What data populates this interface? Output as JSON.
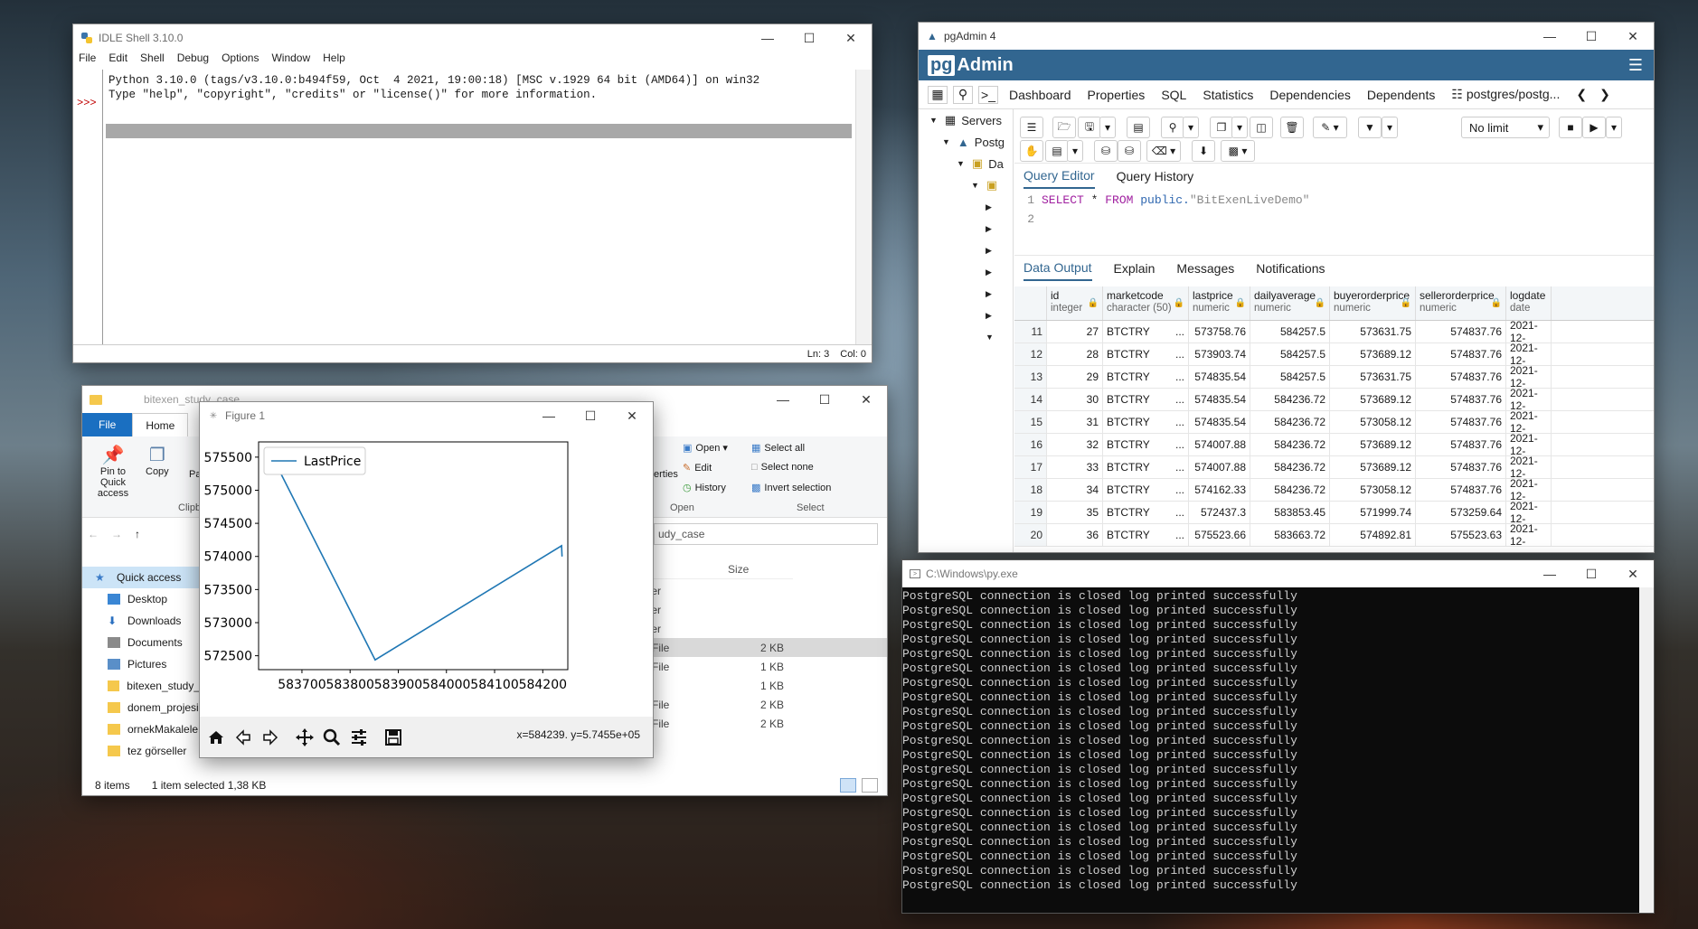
{
  "idle": {
    "title": "IDLE Shell 3.10.0",
    "menu": [
      "File",
      "Edit",
      "Shell",
      "Debug",
      "Options",
      "Window",
      "Help"
    ],
    "lines": [
      "Python 3.10.0 (tags/v3.10.0:b494f59, Oct  4 2021, 19:00:18) [MSC v.1929 64 bit (AMD64)] on win32",
      "Type \"help\", \"copyright\", \"credits\" or \"license()\" for more information."
    ],
    "prompt": ">>>",
    "status_line": "Ln: 3",
    "status_col": "Col: 0"
  },
  "explorer": {
    "title": "bitexen_study_case",
    "tab_file": "File",
    "tab_home": "Home",
    "ribbon": {
      "pin": "Pin to Quick access",
      "copy": "Copy",
      "paste_partial": "Pa",
      "clipboard_partial": "Clipb",
      "properties_partial": "erties",
      "open": "Open",
      "edit": "Edit",
      "history": "History",
      "open_group": "Open",
      "select_all": "Select all",
      "select_none": "Select none",
      "invert_selection": "Invert selection",
      "select_group": "Select"
    },
    "address_partial": "udy_case",
    "column_size": "Size",
    "nav": [
      {
        "label": "Quick access",
        "kind": "star"
      },
      {
        "label": "Desktop",
        "kind": "desktop"
      },
      {
        "label": "Downloads",
        "kind": "download"
      },
      {
        "label": "Documents",
        "kind": "docs"
      },
      {
        "label": "Pictures",
        "kind": "pics"
      },
      {
        "label": "bitexen_study_",
        "kind": "folder"
      },
      {
        "label": "donem_projesi",
        "kind": "folder"
      },
      {
        "label": "ornekMakalele",
        "kind": "folder"
      },
      {
        "label": "tez görseller",
        "kind": "folder"
      }
    ],
    "files": [
      {
        "type": "lder",
        "size": ""
      },
      {
        "type": "lder",
        "size": ""
      },
      {
        "type": "lder",
        "size": ""
      },
      {
        "type": "n File",
        "size": "2 KB"
      },
      {
        "type": "n File",
        "size": "1 KB"
      },
      {
        "type": "le",
        "size": "1 KB"
      },
      {
        "type": "n File",
        "size": "2 KB"
      },
      {
        "type": "n File",
        "size": "2 KB"
      }
    ],
    "status_items": "8 items",
    "status_selected": "1 item selected  1,38 KB"
  },
  "figure": {
    "title": "Figure 1",
    "coords": "x=584239. y=5.7455e+05"
  },
  "chart_data": {
    "type": "line",
    "title": "",
    "xlabel": "",
    "ylabel": "",
    "series": [
      {
        "name": "LastPrice",
        "color": "#1f77b4",
        "x": [
          583632,
          583852,
          584239,
          584240
        ],
        "y": [
          575600,
          572437,
          574162,
          574008
        ]
      }
    ],
    "xlim": [
      583610,
      584252
    ],
    "ylim": [
      572290,
      575730
    ],
    "xticks": [
      583700,
      583800,
      583900,
      584000,
      584100,
      584200
    ],
    "yticks": [
      572500,
      573000,
      573500,
      574000,
      574500,
      575000,
      575500
    ],
    "legend": "top-left",
    "grid": false
  },
  "pgadmin": {
    "title": "pgAdmin 4",
    "brand": "Admin",
    "brand_pg": "pg",
    "tabs": [
      "Dashboard",
      "Properties",
      "SQL",
      "Statistics",
      "Dependencies",
      "Dependents"
    ],
    "query_tab": "postgres/postg...",
    "tree": [
      "Servers",
      "Postg",
      "Da"
    ],
    "limit": "No limit",
    "editor_tabs": [
      "Query Editor",
      "Query History"
    ],
    "sql": {
      "kw1": "SELECT",
      "star": " * ",
      "kw2": "FROM",
      "schema": " public.",
      "table": "\"BitExenLiveDemo\""
    },
    "output_tabs": [
      "Data Output",
      "Explain",
      "Messages",
      "Notifications"
    ],
    "columns": [
      {
        "name": "id",
        "type": "integer"
      },
      {
        "name": "marketcode",
        "type": "character (50)"
      },
      {
        "name": "lastprice",
        "type": "numeric"
      },
      {
        "name": "dailyaverage",
        "type": "numeric"
      },
      {
        "name": "buyerorderprice",
        "type": "numeric"
      },
      {
        "name": "sellerorderprice",
        "type": "numeric"
      },
      {
        "name": "logdate",
        "type": "date"
      }
    ],
    "rows": [
      [
        "11",
        "27",
        "BTCTRY",
        "573758.76",
        "584257.5",
        "573631.75",
        "574837.76",
        "2021-12-"
      ],
      [
        "12",
        "28",
        "BTCTRY",
        "573903.74",
        "584257.5",
        "573689.12",
        "574837.76",
        "2021-12-"
      ],
      [
        "13",
        "29",
        "BTCTRY",
        "574835.54",
        "584257.5",
        "573631.75",
        "574837.76",
        "2021-12-"
      ],
      [
        "14",
        "30",
        "BTCTRY",
        "574835.54",
        "584236.72",
        "573689.12",
        "574837.76",
        "2021-12-"
      ],
      [
        "15",
        "31",
        "BTCTRY",
        "574835.54",
        "584236.72",
        "573058.12",
        "574837.76",
        "2021-12-"
      ],
      [
        "16",
        "32",
        "BTCTRY",
        "574007.88",
        "584236.72",
        "573689.12",
        "574837.76",
        "2021-12-"
      ],
      [
        "17",
        "33",
        "BTCTRY",
        "574007.88",
        "584236.72",
        "573689.12",
        "574837.76",
        "2021-12-"
      ],
      [
        "18",
        "34",
        "BTCTRY",
        "574162.33",
        "584236.72",
        "573058.12",
        "574837.76",
        "2021-12-"
      ],
      [
        "19",
        "35",
        "BTCTRY",
        "572437.3",
        "583853.45",
        "571999.74",
        "573259.64",
        "2021-12-"
      ],
      [
        "20",
        "36",
        "BTCTRY",
        "575523.66",
        "583663.72",
        "574892.81",
        "575523.63",
        "2021-12-"
      ]
    ]
  },
  "console": {
    "title": "C:\\Windows\\py.exe",
    "line": "PostgreSQL connection is closed log printed successfully",
    "line_count": 21
  }
}
